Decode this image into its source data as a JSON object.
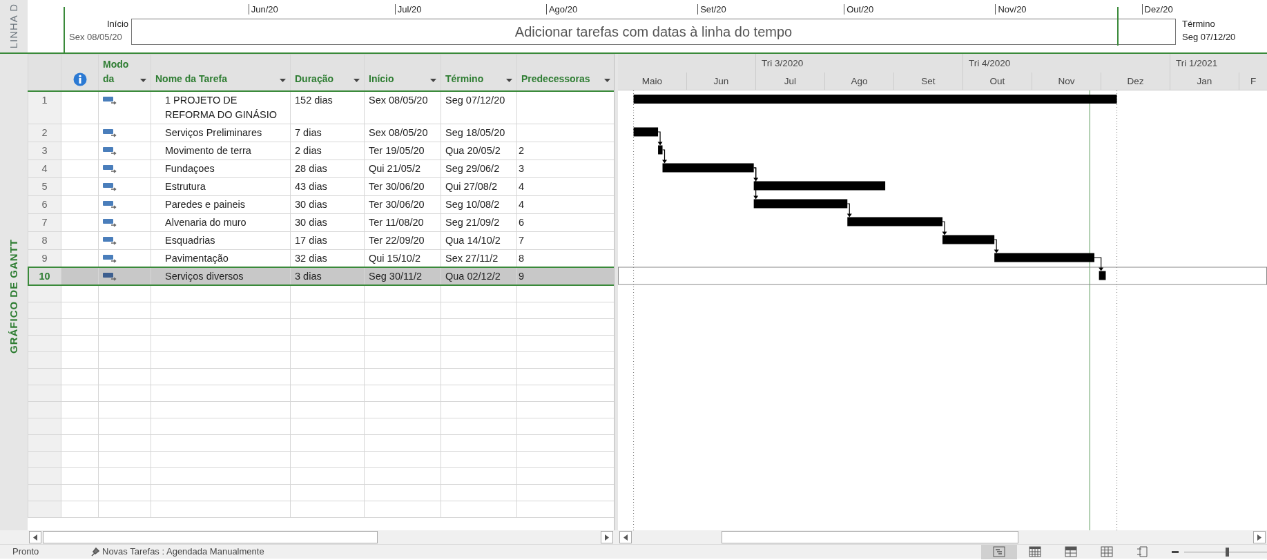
{
  "timeline": {
    "side_label": "LINHA D",
    "start_label": "Início",
    "start_date": "Sex 08/05/20",
    "placeholder": "Adicionar tarefas com datas à linha do tempo",
    "finish_label": "Término",
    "finish_date": "Seg 07/12/20",
    "ticks": [
      "Jun/20",
      "Jul/20",
      "Ago/20",
      "Set/20",
      "Out/20",
      "Nov/20",
      "Dez/20"
    ]
  },
  "view_label": "GRÁFICO DE GANTT",
  "table": {
    "columns": [
      {
        "kind": "info"
      },
      {
        "kind": "text",
        "label": "Modo da"
      },
      {
        "kind": "text",
        "label": "Nome da Tarefa"
      },
      {
        "kind": "text",
        "label": "Duração"
      },
      {
        "kind": "text",
        "label": "Início"
      },
      {
        "kind": "text",
        "label": "Término"
      },
      {
        "kind": "text",
        "label": "Predecessoras"
      }
    ],
    "rows": [
      {
        "id": "1",
        "name": "1 PROJETO DE REFORMA DO GINÁSIO",
        "duration": "152 dias",
        "start": "Sex 08/05/20",
        "finish": "Seg 07/12/20",
        "selected": false
      },
      {
        "id": "2",
        "name": "Serviços Preliminares",
        "duration": "7 dias",
        "start": "Sex 08/05/20",
        "finish": "Seg 18/05/20",
        "selected": false
      },
      {
        "id": "3",
        "name": "Movimento de terra",
        "duration": "2 dias",
        "start": "Ter 19/05/20",
        "finish": "Qua 20/05/2",
        "predecessors": "2",
        "selected": false
      },
      {
        "id": "4",
        "name": "Fundaçoes",
        "duration": "28 dias",
        "start": "Qui 21/05/2",
        "finish": "Seg 29/06/2",
        "predecessors": "3",
        "selected": false
      },
      {
        "id": "5",
        "name": "Estrutura",
        "duration": "43 dias",
        "start": "Ter 30/06/20",
        "finish": "Qui 27/08/2",
        "predecessors": "4",
        "selected": false
      },
      {
        "id": "6",
        "name": "Paredes e paineis",
        "duration": "30 dias",
        "start": "Ter 30/06/20",
        "finish": "Seg 10/08/2",
        "predecessors": "4",
        "selected": false
      },
      {
        "id": "7",
        "name": "Alvenaria do muro",
        "duration": "30 dias",
        "start": "Ter 11/08/20",
        "finish": "Seg 21/09/2",
        "predecessors": "6",
        "selected": false
      },
      {
        "id": "8",
        "name": "Esquadrias",
        "duration": "17 dias",
        "start": "Ter 22/09/20",
        "finish": "Qua 14/10/2",
        "predecessors": "7",
        "selected": false
      },
      {
        "id": "9",
        "name": "Pavimentação",
        "duration": "32 dias",
        "start": "Qui 15/10/2",
        "finish": "Sex 27/11/2",
        "predecessors": "8",
        "selected": false
      },
      {
        "id": "10",
        "name": "Serviços diversos",
        "duration": "3 dias",
        "start": "Seg 30/11/2",
        "finish": "Qua 02/12/2",
        "predecessors": "9",
        "selected": true
      }
    ]
  },
  "gantt": {
    "quarters": [
      "Tri 3/2020",
      "Tri 4/2020",
      "Tri 1/2021"
    ],
    "months": [
      "Maio",
      "Jun",
      "Jul",
      "Ago",
      "Set",
      "Out",
      "Nov",
      "Dez",
      "Jan",
      "F"
    ]
  },
  "status_bar": {
    "text": "Pronto",
    "new_tasks": "Novas Tarefas : Agendada Manualmente",
    "views": [
      {
        "kind": "gantt",
        "selected": true
      },
      {
        "kind": "usage",
        "selected": false
      },
      {
        "kind": "team",
        "selected": false
      },
      {
        "kind": "sheet",
        "selected": false
      },
      {
        "kind": "report",
        "selected": false
      }
    ]
  }
}
